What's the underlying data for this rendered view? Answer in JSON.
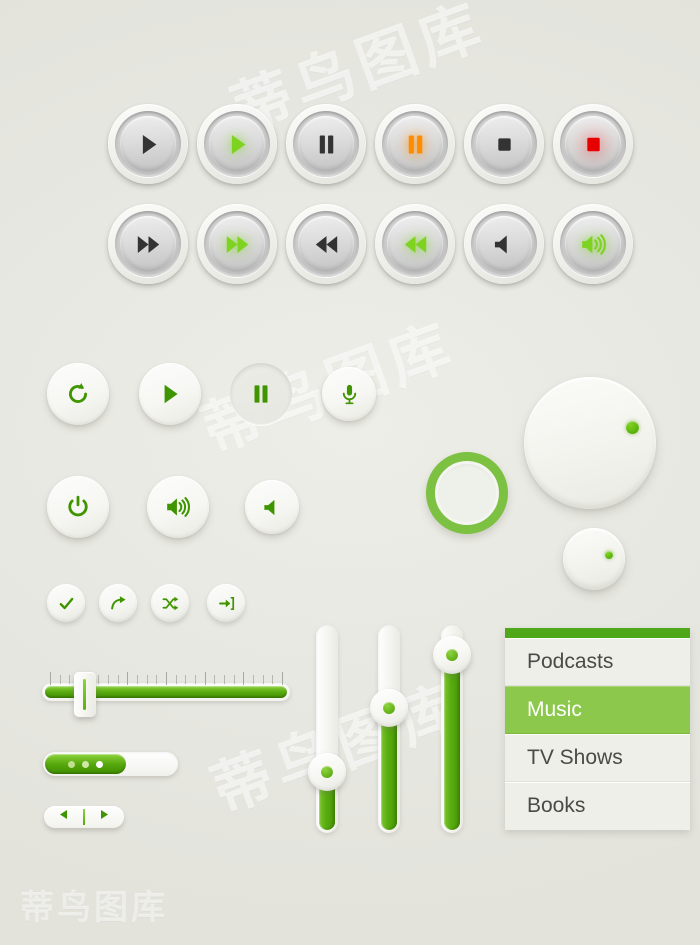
{
  "watermark": {
    "line1": "蒂鸟图库",
    "line2": "蒂鸟图库",
    "line3": "蒂鸟图库",
    "corner": "蒂鸟图库"
  },
  "colors": {
    "background": "#e9e9e3",
    "accent_green": "#7ed321",
    "green_dark": "#4a9a05",
    "green_light": "#8cc84b",
    "menu_bar_green": "#4fa81a",
    "orange": "#ff8c00",
    "red": "#e60000",
    "dark_glyph": "#333333"
  },
  "glossy_buttons": {
    "row1": [
      {
        "name": "play-button",
        "icon": "play-icon",
        "state": "default",
        "color": "#333333"
      },
      {
        "name": "play-button-active",
        "icon": "play-icon",
        "state": "active",
        "color": "#7ed321"
      },
      {
        "name": "pause-button",
        "icon": "pause-icon",
        "state": "default",
        "color": "#333333"
      },
      {
        "name": "pause-button-active",
        "icon": "pause-icon",
        "state": "active",
        "color": "#ff8c00"
      },
      {
        "name": "stop-button",
        "icon": "stop-icon",
        "state": "default",
        "color": "#333333"
      },
      {
        "name": "record-button-active",
        "icon": "record-icon",
        "state": "active",
        "color": "#e60000"
      }
    ],
    "row2": [
      {
        "name": "fast-forward-button",
        "icon": "fast-forward-icon",
        "state": "default",
        "color": "#333333"
      },
      {
        "name": "fast-forward-button-active",
        "icon": "fast-forward-icon",
        "state": "active",
        "color": "#7ed321"
      },
      {
        "name": "rewind-button",
        "icon": "rewind-icon",
        "state": "default",
        "color": "#333333"
      },
      {
        "name": "rewind-button-active",
        "icon": "rewind-icon",
        "state": "active",
        "color": "#7ed321"
      },
      {
        "name": "volume-mute-button",
        "icon": "speaker-mute-icon",
        "state": "default",
        "color": "#333333"
      },
      {
        "name": "volume-up-button-active",
        "icon": "speaker-waves-icon",
        "state": "active",
        "color": "#7ed321"
      }
    ]
  },
  "soft_buttons": {
    "row1": [
      {
        "name": "refresh-button",
        "icon": "refresh-icon",
        "size": 62
      },
      {
        "name": "play-button",
        "icon": "play-icon",
        "size": 62
      },
      {
        "name": "pause-button",
        "icon": "pause-icon",
        "size": 62,
        "pressed": true
      },
      {
        "name": "microphone-button",
        "icon": "microphone-icon",
        "size": 54
      }
    ],
    "row2": [
      {
        "name": "power-button",
        "icon": "power-icon",
        "size": 62
      },
      {
        "name": "volume-up-button",
        "icon": "speaker-waves-icon",
        "size": 62
      },
      {
        "name": "volume-mute-button",
        "icon": "speaker-mute-icon",
        "size": 54
      }
    ],
    "small_row": [
      {
        "name": "check-button",
        "icon": "check-icon"
      },
      {
        "name": "share-button",
        "icon": "share-arrow-icon"
      },
      {
        "name": "shuffle-button",
        "icon": "shuffle-icon"
      },
      {
        "name": "login-button",
        "icon": "login-arrow-icon"
      }
    ]
  },
  "knobs": [
    {
      "name": "volume-knob-large",
      "diameter": 132,
      "indicator_angle_deg": 35,
      "indicator_size": 13
    },
    {
      "name": "volume-knob-small",
      "diameter": 62,
      "indicator_angle_deg": 40,
      "indicator_size": 8
    },
    {
      "name": "volume-knob-green-ring",
      "diameter": 80,
      "indicator_angle_deg": 25,
      "indicator_size": 11
    }
  ],
  "ruler_slider": {
    "name": "ruler-slider",
    "value_percent": 14,
    "fill_percent": 100,
    "tick_count": 25,
    "major_every": 4
  },
  "pill_toggle": {
    "name": "pill-progress",
    "filled_percent": 62,
    "dots": [
      {
        "color": "#bfe08c"
      },
      {
        "color": "#cfe8a8"
      },
      {
        "color": "#ffffff"
      }
    ]
  },
  "prev_next": {
    "name": "prev-next-control",
    "prev_icon": "triangle-left-icon",
    "next_icon": "triangle-right-icon"
  },
  "vertical_sliders": [
    {
      "name": "vertical-slider-1",
      "value_percent": 30
    },
    {
      "name": "vertical-slider-2",
      "value_percent": 62
    },
    {
      "name": "vertical-slider-3",
      "value_percent": 88
    }
  ],
  "menu": {
    "name": "category-menu",
    "items": [
      {
        "label": "Podcasts",
        "selected": false
      },
      {
        "label": "Music",
        "selected": true
      },
      {
        "label": "TV Shows",
        "selected": false
      },
      {
        "label": "Books",
        "selected": false
      }
    ]
  }
}
